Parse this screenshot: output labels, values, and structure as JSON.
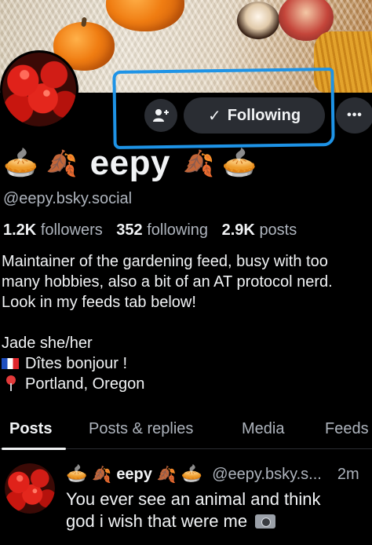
{
  "profile": {
    "display_name": "eepy",
    "handle": "@eepy.bsky.social",
    "name_emoji_left": [
      "🥧",
      "🍂"
    ],
    "name_emoji_right": [
      "🍂",
      "🥧"
    ],
    "stats": {
      "followers_count": "1.2K",
      "followers_label": "followers",
      "following_count": "352",
      "following_label": "following",
      "posts_count": "2.9K",
      "posts_label": "posts"
    },
    "bio_lines": [
      "Maintainer of the gardening feed, busy with too",
      "many hobbies, also a bit of an AT protocol nerd.",
      "Look in my feeds tab below!",
      "",
      "Jade she/her",
      "Dîtes bonjour !",
      "Portland, Oregon"
    ]
  },
  "actions": {
    "add_user_icon": "add-user-icon",
    "follow_check": "✓",
    "follow_label": "Following",
    "more_label": "•••"
  },
  "tabs": [
    {
      "label": "Posts",
      "active": true
    },
    {
      "label": "Posts & replies",
      "active": false
    },
    {
      "label": "Media",
      "active": false
    },
    {
      "label": "Feeds",
      "active": false
    }
  ],
  "post": {
    "author_name": "eepy",
    "author_handle": "@eepy.bsky.s...",
    "time": "2m",
    "text_lines": [
      "You ever see an animal and think",
      "god i wish that were me"
    ]
  },
  "colors": {
    "background": "#000000",
    "highlight": "#1e93e6",
    "button_bg": "#2a2d33",
    "muted_text": "#aeb4bd"
  }
}
